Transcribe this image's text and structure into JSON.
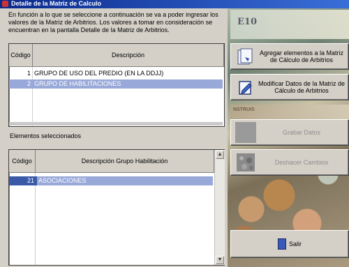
{
  "window": {
    "title": "Detalle de la Matriz de Calculo"
  },
  "intro_text": "En función a lo que se seleccione a continuación se va a poder ingresar los valores de la Matriz de Arbitrios. Los valores a tomar en consideración se encuentran en la pantalla Detalle de la Matriz de Arbitrios.",
  "grid_top": {
    "headers": {
      "codigo": "Código",
      "descripcion": "Descripción"
    },
    "rows": [
      {
        "codigo": "1",
        "descripcion": "GRUPO DE USO DEL PREDIO (EN LA DDJJ)",
        "selected": false
      },
      {
        "codigo": "2",
        "descripcion": "GRUPO DE HABILITACIONES",
        "selected": true
      }
    ]
  },
  "selected_label": "Elementos seleccionados",
  "grid_bottom": {
    "headers": {
      "codigo": "Código",
      "descripcion": "Descripción Grupo Habilitación"
    },
    "rows": [
      {
        "codigo": "21",
        "descripcion": "ASOCIACIONES",
        "selected": true
      }
    ]
  },
  "buttons": {
    "agregar": "Agregar elementos a la Matriz de Cálculo de Arbitrios",
    "modificar": "Modificar Datos de la Matriz de Cálculo de Arbitrios",
    "grabar": "Grabar Datos",
    "deshacer": "Deshacer Cambios",
    "salir": "Salir"
  },
  "background_text": {
    "banknote_1": "E10",
    "banknote_2": "NSTRUIS"
  },
  "colors": {
    "titlebar": "#0b2a8c",
    "selection": "#98a8d8",
    "panel": "#d4d0c8"
  }
}
